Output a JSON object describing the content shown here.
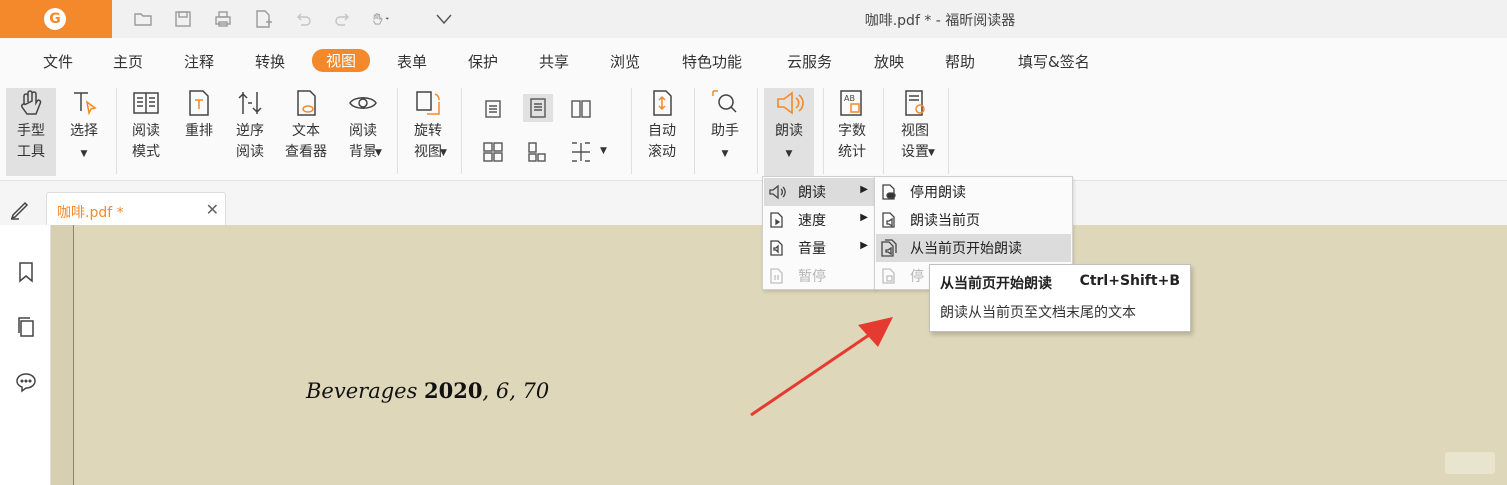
{
  "window": {
    "title": "咖啡.pdf * - 福昕阅读器"
  },
  "menu": [
    "文件",
    "主页",
    "注释",
    "转换",
    "视图",
    "表单",
    "保护",
    "共享",
    "浏览",
    "特色功能",
    "云服务",
    "放映",
    "帮助",
    "填写&签名"
  ],
  "active_menu": "视图",
  "ribbon": {
    "hand_tool": "手型\n工具",
    "select": "选择",
    "read_mode": "阅读\n模式",
    "reflow": "重排",
    "reverse_read": "逆序\n阅读",
    "text_viewer": "文本\n查看器",
    "read_bg": "阅读\n背景",
    "rotate_view": "旋转\n视图",
    "auto_scroll": "自动\n滚动",
    "assistant": "助手",
    "read_aloud": "朗读",
    "word_count": "字数\n统计",
    "view_settings": "视图\n设置"
  },
  "tab": {
    "label": "咖啡.pdf *"
  },
  "document": {
    "journal": "Beverages",
    "year": "2020",
    "volume_issue": ", 6, 70"
  },
  "submenu": {
    "items": [
      {
        "label": "朗读",
        "icon": "speaker-icon",
        "has_sub": true,
        "highlighted": true
      },
      {
        "label": "速度",
        "icon": "speed-icon",
        "has_sub": true
      },
      {
        "label": "音量",
        "icon": "volume-icon",
        "has_sub": true
      },
      {
        "label": "暂停",
        "icon": "pause-icon",
        "disabled": true
      }
    ]
  },
  "flyout": {
    "items": [
      {
        "label": "停用朗读",
        "icon": "stop-read-icon"
      },
      {
        "label": "朗读当前页",
        "icon": "read-page-icon"
      },
      {
        "label": "从当前页开始朗读",
        "icon": "read-from-page-icon",
        "highlighted": true
      },
      {
        "label": "停",
        "icon": "stop-icon",
        "disabled": true
      }
    ]
  },
  "tooltip": {
    "title": "从当前页开始朗读",
    "shortcut": "Ctrl+Shift+B",
    "description": "朗读从当前页至文档末尾的文本"
  },
  "colors": {
    "accent": "#f3892a",
    "document_bg": "#ded7b9",
    "arrow": "#e53a2f"
  }
}
